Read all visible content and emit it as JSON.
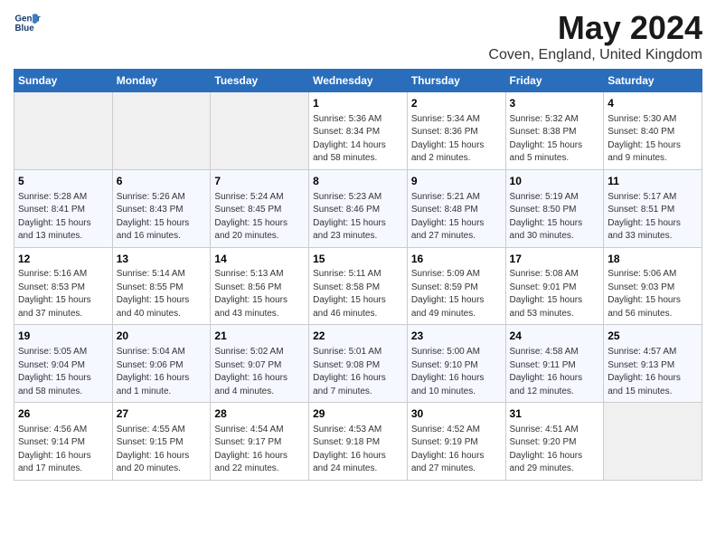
{
  "header": {
    "logo_line1": "General",
    "logo_line2": "Blue",
    "month_year": "May 2024",
    "location": "Coven, England, United Kingdom"
  },
  "weekdays": [
    "Sunday",
    "Monday",
    "Tuesday",
    "Wednesday",
    "Thursday",
    "Friday",
    "Saturday"
  ],
  "weeks": [
    [
      {
        "day": "",
        "text": ""
      },
      {
        "day": "",
        "text": ""
      },
      {
        "day": "",
        "text": ""
      },
      {
        "day": "1",
        "text": "Sunrise: 5:36 AM\nSunset: 8:34 PM\nDaylight: 14 hours\nand 58 minutes."
      },
      {
        "day": "2",
        "text": "Sunrise: 5:34 AM\nSunset: 8:36 PM\nDaylight: 15 hours\nand 2 minutes."
      },
      {
        "day": "3",
        "text": "Sunrise: 5:32 AM\nSunset: 8:38 PM\nDaylight: 15 hours\nand 5 minutes."
      },
      {
        "day": "4",
        "text": "Sunrise: 5:30 AM\nSunset: 8:40 PM\nDaylight: 15 hours\nand 9 minutes."
      }
    ],
    [
      {
        "day": "5",
        "text": "Sunrise: 5:28 AM\nSunset: 8:41 PM\nDaylight: 15 hours\nand 13 minutes."
      },
      {
        "day": "6",
        "text": "Sunrise: 5:26 AM\nSunset: 8:43 PM\nDaylight: 15 hours\nand 16 minutes."
      },
      {
        "day": "7",
        "text": "Sunrise: 5:24 AM\nSunset: 8:45 PM\nDaylight: 15 hours\nand 20 minutes."
      },
      {
        "day": "8",
        "text": "Sunrise: 5:23 AM\nSunset: 8:46 PM\nDaylight: 15 hours\nand 23 minutes."
      },
      {
        "day": "9",
        "text": "Sunrise: 5:21 AM\nSunset: 8:48 PM\nDaylight: 15 hours\nand 27 minutes."
      },
      {
        "day": "10",
        "text": "Sunrise: 5:19 AM\nSunset: 8:50 PM\nDaylight: 15 hours\nand 30 minutes."
      },
      {
        "day": "11",
        "text": "Sunrise: 5:17 AM\nSunset: 8:51 PM\nDaylight: 15 hours\nand 33 minutes."
      }
    ],
    [
      {
        "day": "12",
        "text": "Sunrise: 5:16 AM\nSunset: 8:53 PM\nDaylight: 15 hours\nand 37 minutes."
      },
      {
        "day": "13",
        "text": "Sunrise: 5:14 AM\nSunset: 8:55 PM\nDaylight: 15 hours\nand 40 minutes."
      },
      {
        "day": "14",
        "text": "Sunrise: 5:13 AM\nSunset: 8:56 PM\nDaylight: 15 hours\nand 43 minutes."
      },
      {
        "day": "15",
        "text": "Sunrise: 5:11 AM\nSunset: 8:58 PM\nDaylight: 15 hours\nand 46 minutes."
      },
      {
        "day": "16",
        "text": "Sunrise: 5:09 AM\nSunset: 8:59 PM\nDaylight: 15 hours\nand 49 minutes."
      },
      {
        "day": "17",
        "text": "Sunrise: 5:08 AM\nSunset: 9:01 PM\nDaylight: 15 hours\nand 53 minutes."
      },
      {
        "day": "18",
        "text": "Sunrise: 5:06 AM\nSunset: 9:03 PM\nDaylight: 15 hours\nand 56 minutes."
      }
    ],
    [
      {
        "day": "19",
        "text": "Sunrise: 5:05 AM\nSunset: 9:04 PM\nDaylight: 15 hours\nand 58 minutes."
      },
      {
        "day": "20",
        "text": "Sunrise: 5:04 AM\nSunset: 9:06 PM\nDaylight: 16 hours\nand 1 minute."
      },
      {
        "day": "21",
        "text": "Sunrise: 5:02 AM\nSunset: 9:07 PM\nDaylight: 16 hours\nand 4 minutes."
      },
      {
        "day": "22",
        "text": "Sunrise: 5:01 AM\nSunset: 9:08 PM\nDaylight: 16 hours\nand 7 minutes."
      },
      {
        "day": "23",
        "text": "Sunrise: 5:00 AM\nSunset: 9:10 PM\nDaylight: 16 hours\nand 10 minutes."
      },
      {
        "day": "24",
        "text": "Sunrise: 4:58 AM\nSunset: 9:11 PM\nDaylight: 16 hours\nand 12 minutes."
      },
      {
        "day": "25",
        "text": "Sunrise: 4:57 AM\nSunset: 9:13 PM\nDaylight: 16 hours\nand 15 minutes."
      }
    ],
    [
      {
        "day": "26",
        "text": "Sunrise: 4:56 AM\nSunset: 9:14 PM\nDaylight: 16 hours\nand 17 minutes."
      },
      {
        "day": "27",
        "text": "Sunrise: 4:55 AM\nSunset: 9:15 PM\nDaylight: 16 hours\nand 20 minutes."
      },
      {
        "day": "28",
        "text": "Sunrise: 4:54 AM\nSunset: 9:17 PM\nDaylight: 16 hours\nand 22 minutes."
      },
      {
        "day": "29",
        "text": "Sunrise: 4:53 AM\nSunset: 9:18 PM\nDaylight: 16 hours\nand 24 minutes."
      },
      {
        "day": "30",
        "text": "Sunrise: 4:52 AM\nSunset: 9:19 PM\nDaylight: 16 hours\nand 27 minutes."
      },
      {
        "day": "31",
        "text": "Sunrise: 4:51 AM\nSunset: 9:20 PM\nDaylight: 16 hours\nand 29 minutes."
      },
      {
        "day": "",
        "text": ""
      }
    ]
  ]
}
